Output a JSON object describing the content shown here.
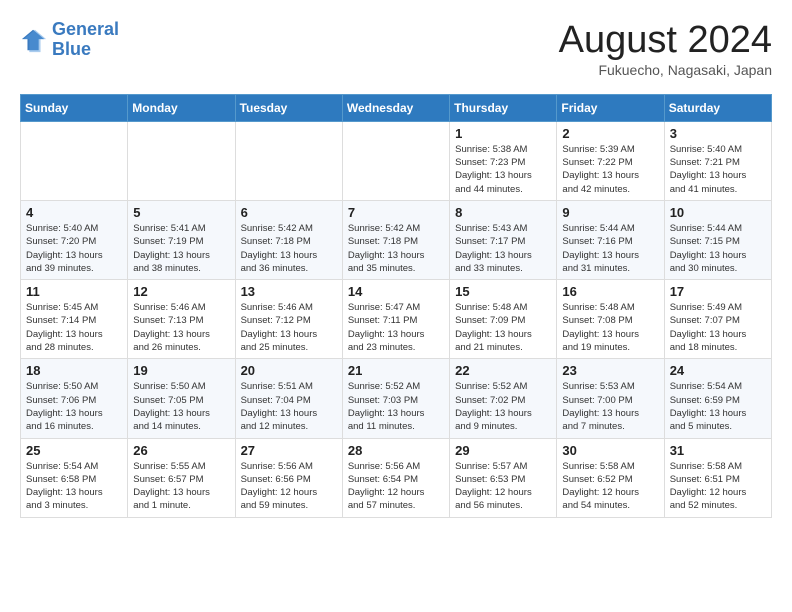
{
  "header": {
    "logo_line1": "General",
    "logo_line2": "Blue",
    "month_title": "August 2024",
    "location": "Fukuecho, Nagasaki, Japan"
  },
  "weekdays": [
    "Sunday",
    "Monday",
    "Tuesday",
    "Wednesday",
    "Thursday",
    "Friday",
    "Saturday"
  ],
  "weeks": [
    [
      {
        "day": "",
        "info": ""
      },
      {
        "day": "",
        "info": ""
      },
      {
        "day": "",
        "info": ""
      },
      {
        "day": "",
        "info": ""
      },
      {
        "day": "1",
        "info": "Sunrise: 5:38 AM\nSunset: 7:23 PM\nDaylight: 13 hours\nand 44 minutes."
      },
      {
        "day": "2",
        "info": "Sunrise: 5:39 AM\nSunset: 7:22 PM\nDaylight: 13 hours\nand 42 minutes."
      },
      {
        "day": "3",
        "info": "Sunrise: 5:40 AM\nSunset: 7:21 PM\nDaylight: 13 hours\nand 41 minutes."
      }
    ],
    [
      {
        "day": "4",
        "info": "Sunrise: 5:40 AM\nSunset: 7:20 PM\nDaylight: 13 hours\nand 39 minutes."
      },
      {
        "day": "5",
        "info": "Sunrise: 5:41 AM\nSunset: 7:19 PM\nDaylight: 13 hours\nand 38 minutes."
      },
      {
        "day": "6",
        "info": "Sunrise: 5:42 AM\nSunset: 7:18 PM\nDaylight: 13 hours\nand 36 minutes."
      },
      {
        "day": "7",
        "info": "Sunrise: 5:42 AM\nSunset: 7:18 PM\nDaylight: 13 hours\nand 35 minutes."
      },
      {
        "day": "8",
        "info": "Sunrise: 5:43 AM\nSunset: 7:17 PM\nDaylight: 13 hours\nand 33 minutes."
      },
      {
        "day": "9",
        "info": "Sunrise: 5:44 AM\nSunset: 7:16 PM\nDaylight: 13 hours\nand 31 minutes."
      },
      {
        "day": "10",
        "info": "Sunrise: 5:44 AM\nSunset: 7:15 PM\nDaylight: 13 hours\nand 30 minutes."
      }
    ],
    [
      {
        "day": "11",
        "info": "Sunrise: 5:45 AM\nSunset: 7:14 PM\nDaylight: 13 hours\nand 28 minutes."
      },
      {
        "day": "12",
        "info": "Sunrise: 5:46 AM\nSunset: 7:13 PM\nDaylight: 13 hours\nand 26 minutes."
      },
      {
        "day": "13",
        "info": "Sunrise: 5:46 AM\nSunset: 7:12 PM\nDaylight: 13 hours\nand 25 minutes."
      },
      {
        "day": "14",
        "info": "Sunrise: 5:47 AM\nSunset: 7:11 PM\nDaylight: 13 hours\nand 23 minutes."
      },
      {
        "day": "15",
        "info": "Sunrise: 5:48 AM\nSunset: 7:09 PM\nDaylight: 13 hours\nand 21 minutes."
      },
      {
        "day": "16",
        "info": "Sunrise: 5:48 AM\nSunset: 7:08 PM\nDaylight: 13 hours\nand 19 minutes."
      },
      {
        "day": "17",
        "info": "Sunrise: 5:49 AM\nSunset: 7:07 PM\nDaylight: 13 hours\nand 18 minutes."
      }
    ],
    [
      {
        "day": "18",
        "info": "Sunrise: 5:50 AM\nSunset: 7:06 PM\nDaylight: 13 hours\nand 16 minutes."
      },
      {
        "day": "19",
        "info": "Sunrise: 5:50 AM\nSunset: 7:05 PM\nDaylight: 13 hours\nand 14 minutes."
      },
      {
        "day": "20",
        "info": "Sunrise: 5:51 AM\nSunset: 7:04 PM\nDaylight: 13 hours\nand 12 minutes."
      },
      {
        "day": "21",
        "info": "Sunrise: 5:52 AM\nSunset: 7:03 PM\nDaylight: 13 hours\nand 11 minutes."
      },
      {
        "day": "22",
        "info": "Sunrise: 5:52 AM\nSunset: 7:02 PM\nDaylight: 13 hours\nand 9 minutes."
      },
      {
        "day": "23",
        "info": "Sunrise: 5:53 AM\nSunset: 7:00 PM\nDaylight: 13 hours\nand 7 minutes."
      },
      {
        "day": "24",
        "info": "Sunrise: 5:54 AM\nSunset: 6:59 PM\nDaylight: 13 hours\nand 5 minutes."
      }
    ],
    [
      {
        "day": "25",
        "info": "Sunrise: 5:54 AM\nSunset: 6:58 PM\nDaylight: 13 hours\nand 3 minutes."
      },
      {
        "day": "26",
        "info": "Sunrise: 5:55 AM\nSunset: 6:57 PM\nDaylight: 13 hours\nand 1 minute."
      },
      {
        "day": "27",
        "info": "Sunrise: 5:56 AM\nSunset: 6:56 PM\nDaylight: 12 hours\nand 59 minutes."
      },
      {
        "day": "28",
        "info": "Sunrise: 5:56 AM\nSunset: 6:54 PM\nDaylight: 12 hours\nand 57 minutes."
      },
      {
        "day": "29",
        "info": "Sunrise: 5:57 AM\nSunset: 6:53 PM\nDaylight: 12 hours\nand 56 minutes."
      },
      {
        "day": "30",
        "info": "Sunrise: 5:58 AM\nSunset: 6:52 PM\nDaylight: 12 hours\nand 54 minutes."
      },
      {
        "day": "31",
        "info": "Sunrise: 5:58 AM\nSunset: 6:51 PM\nDaylight: 12 hours\nand 52 minutes."
      }
    ]
  ]
}
